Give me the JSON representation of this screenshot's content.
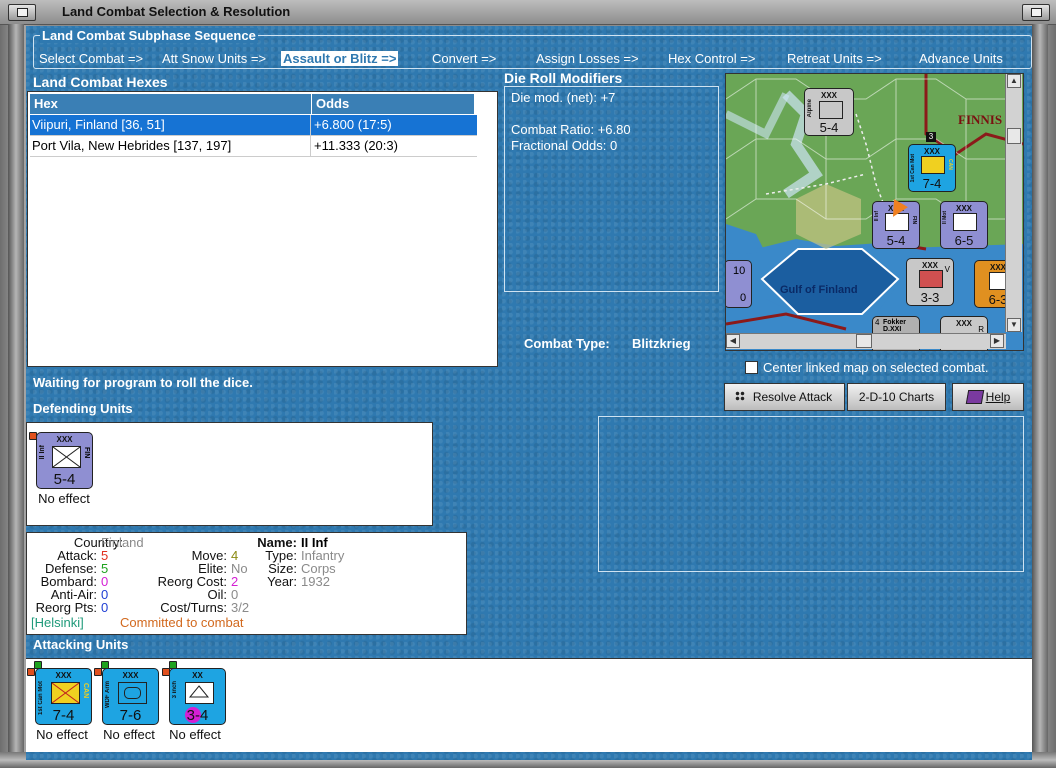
{
  "window": {
    "title": "Land Combat Selection & Resolution"
  },
  "subphase": {
    "legend": "Land Combat Subphase Sequence",
    "steps": [
      {
        "label": "Select Combat =>"
      },
      {
        "label": "Att Snow Units =>"
      },
      {
        "label": "Assault or Blitz =>",
        "active": true
      },
      {
        "label": "Convert =>"
      },
      {
        "label": "Assign Losses =>"
      },
      {
        "label": "Hex Control =>"
      },
      {
        "label": "Retreat Units =>"
      },
      {
        "label": "Advance Units"
      }
    ]
  },
  "hexes": {
    "heading": "Land Combat Hexes",
    "columns": [
      "Hex",
      "Odds"
    ],
    "rows": [
      {
        "hex": "Viipuri, Finland [36, 51]",
        "odds": "+6.800 (17:5)",
        "selected": true
      },
      {
        "hex": "Port Vila, New Hebrides [137, 197]",
        "odds": "+11.333 (20:3)"
      }
    ]
  },
  "modifiers": {
    "heading": "Die Roll Modifiers",
    "line1": "Die mod. (net): +7",
    "line2": "Combat Ratio: +6.80",
    "line3": "Fractional Odds: 0"
  },
  "combat_type": {
    "label": "Combat Type:",
    "value": "Blitzkrieg"
  },
  "map": {
    "sea_label": "Gulf of Finland",
    "region_label": "FINNIS",
    "units": [
      {
        "size": "XXX",
        "name": "Alpine",
        "str": "5-4"
      },
      {
        "size": "XXX",
        "name": "1st Can Mot",
        "str": "7-4",
        "nat": "CAN"
      },
      {
        "size": "XXX",
        "name": "II Inf",
        "str": "5-4",
        "nat": "FIN"
      },
      {
        "size": "XXX",
        "name": "II Mot",
        "str": "6-5",
        "nat": "FIN"
      },
      {
        "size": "XXX",
        "name": "",
        "str": "3-3"
      },
      {
        "size": "XXX",
        "name": "",
        "str": "6-3"
      },
      {
        "size": "",
        "name": "",
        "str": "10"
      },
      {
        "size": "",
        "name": "",
        "str": "0"
      },
      {
        "size": "",
        "name": "Fokker D.XXI",
        "str": "4"
      },
      {
        "size": "XXX",
        "name": "",
        "str": "R"
      },
      {
        "size": "",
        "name": "",
        "str": "V"
      },
      {
        "size": "",
        "name": "",
        "str": "3"
      }
    ]
  },
  "center_linked": {
    "label": "Center linked map on selected combat."
  },
  "status": "Waiting for program to roll the dice.",
  "buttons": {
    "resolve": "Resolve Attack",
    "charts": "2-D-10 Charts",
    "help": "Help"
  },
  "defending": {
    "heading": "Defending Units",
    "units": [
      {
        "size": "XXX",
        "name": "II Inf",
        "nat": "FIN",
        "str": "5-4",
        "result": "No effect"
      }
    ]
  },
  "info": {
    "country_k": "Country:",
    "country_v": "Finland",
    "attack_k": "Attack:",
    "attack_v": "5",
    "defense_k": "Defense:",
    "defense_v": "5",
    "bombard_k": "Bombard:",
    "bombard_v": "0",
    "antiair_k": "Anti-Air:",
    "antiair_v": "0",
    "reorgpts_k": "Reorg Pts:",
    "reorgpts_v": "0",
    "move_k": "Move:",
    "move_v": "4",
    "elite_k": "Elite:",
    "elite_v": "No",
    "reorgcost_k": "Reorg Cost:",
    "reorgcost_v": "2",
    "oil_k": "Oil:",
    "oil_v": "0",
    "costturns_k": "Cost/Turns:",
    "costturns_v": "3/2",
    "name_k": "Name:",
    "name_v": "II Inf",
    "type_k": "Type:",
    "type_v": "Infantry",
    "size_k": "Size:",
    "size_v": "Corps",
    "year_k": "Year:",
    "year_v": "1932",
    "location": "[Helsinki]",
    "committed": "Committed to combat"
  },
  "attacking": {
    "heading": "Attacking Units",
    "units": [
      {
        "size": "XXX",
        "name": "1st Can Mot",
        "nat": "CAN",
        "str": "7-4",
        "result": "No effect"
      },
      {
        "size": "XXX",
        "name": "WDF Arm",
        "str": "7-6",
        "result": "No effect"
      },
      {
        "size": "XX",
        "name": "3 inch",
        "str": "3-4",
        "result": "No effect"
      }
    ]
  },
  "colors": {
    "panel_blue": "#2f79b0",
    "selection": "#1673d4",
    "attack_red": "#e0301e",
    "defense_green": "#1fa21f",
    "bombard_magenta": "#d41fd4",
    "antiair_blue": "#1f3fd4",
    "move_olive": "#8a8a10",
    "committed_orange": "#d2691e",
    "location_teal": "#1f9a7a",
    "gray_value": "#8a8a8a"
  }
}
